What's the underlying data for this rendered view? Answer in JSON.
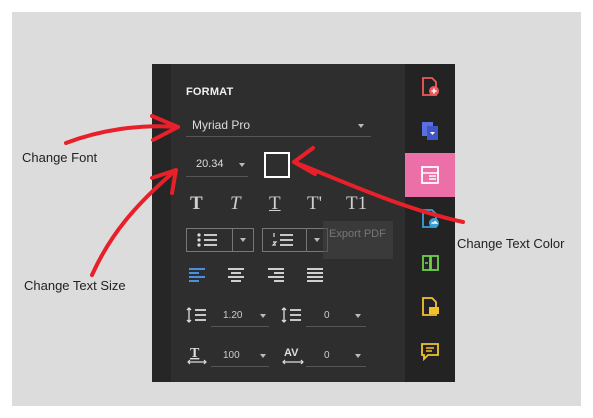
{
  "panel": {
    "heading": "FORMAT",
    "font": {
      "value": "Myriad Pro"
    },
    "size": {
      "value": "20.34"
    },
    "tooltip": "Export PDF",
    "line_spacing": {
      "value": "1.20"
    },
    "para_spacing": {
      "value": "0"
    },
    "char_scale": {
      "value": "100"
    },
    "char_spacing": {
      "value": "0"
    }
  },
  "text_styles": [
    "T",
    "T",
    "T",
    "T'",
    "T1"
  ],
  "annotations": {
    "font": "Change Font",
    "size": "Change Text Size",
    "color": "Change Text Color"
  },
  "colors": {
    "accent_active": "#ec6fa8",
    "blue_align": "#4a90e2",
    "arrow": "#e8202a"
  },
  "sidebar_icons": [
    "add-pdf-icon",
    "convert-pdf-icon",
    "format-icon",
    "export-pdf-icon",
    "organize-icon",
    "comment-pdf-icon",
    "comment-icon"
  ]
}
